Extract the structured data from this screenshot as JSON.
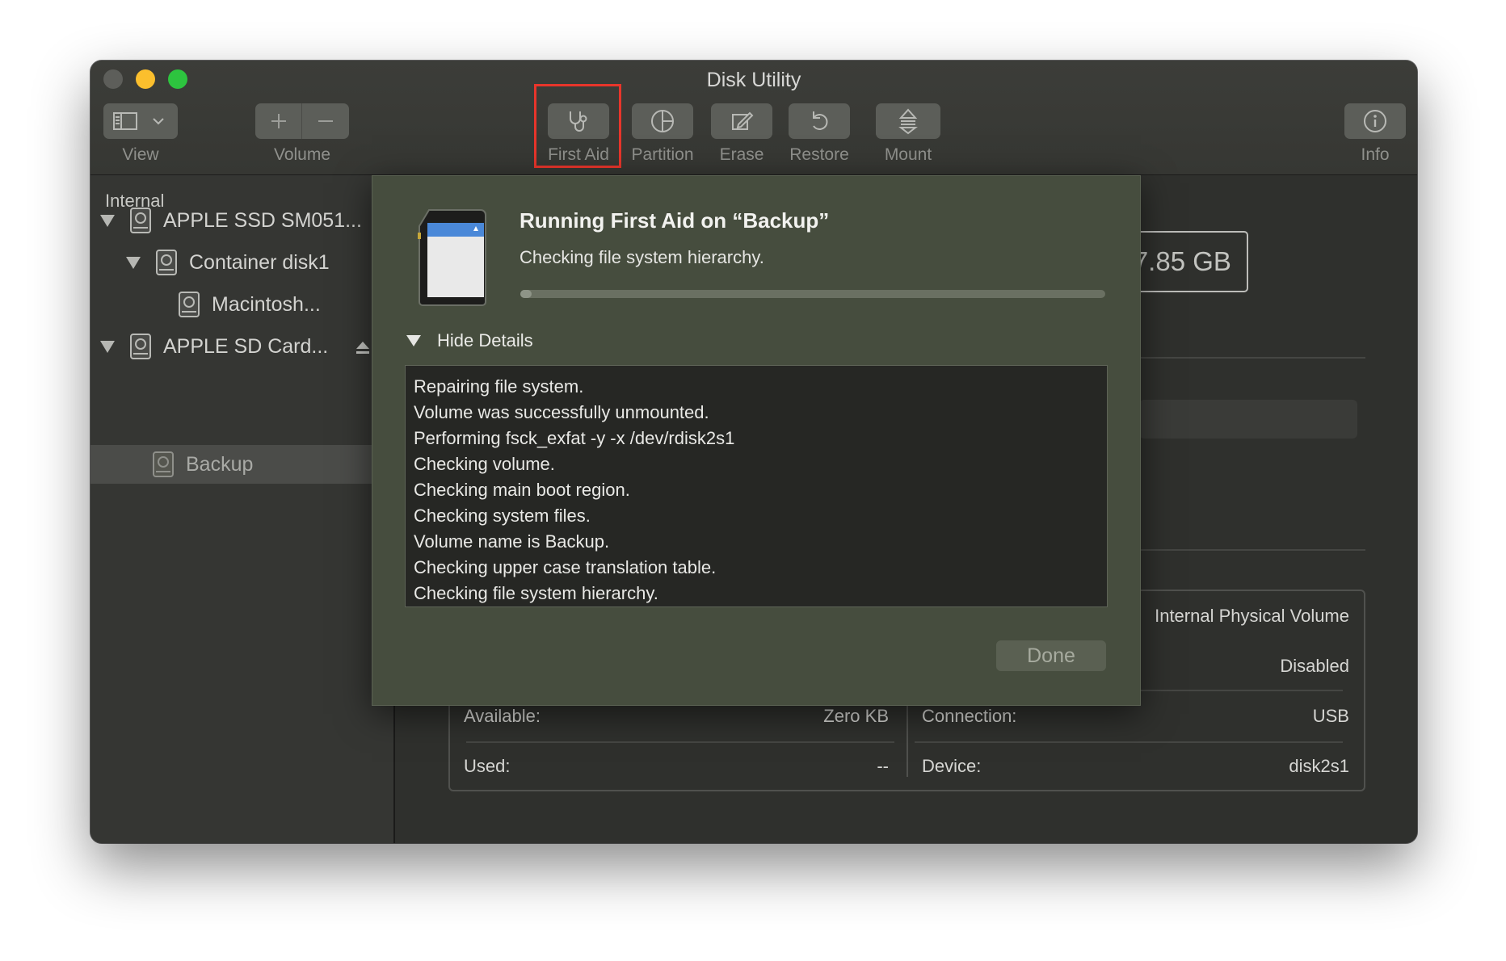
{
  "window": {
    "title": "Disk Utility"
  },
  "toolbar": {
    "view_label": "View",
    "volume_label": "Volume",
    "first_aid_label": "First Aid",
    "partition_label": "Partition",
    "erase_label": "Erase",
    "restore_label": "Restore",
    "mount_label": "Mount",
    "info_label": "Info"
  },
  "sidebar": {
    "header": "Internal",
    "items": [
      {
        "label": "APPLE SSD SM051..."
      },
      {
        "label": "Container disk1"
      },
      {
        "label": "Macintosh..."
      },
      {
        "label": "APPLE SD Card..."
      },
      {
        "label": "Backup"
      }
    ]
  },
  "main": {
    "capacity": "127.85 GB",
    "info": {
      "type_value": "Internal Physical Volume",
      "owners_value": "Disabled",
      "available_label": "Available:",
      "available_value": "Zero KB",
      "connection_label": "Connection:",
      "connection_value": "USB",
      "used_label": "Used:",
      "used_value": "--",
      "device_label": "Device:",
      "device_value": "disk2s1"
    }
  },
  "dialog": {
    "title": "Running First Aid on “Backup”",
    "status": "Checking file system hierarchy.",
    "progress": 0.02,
    "hide_details_label": "Hide Details",
    "log": [
      "Repairing file system.",
      "Volume was successfully unmounted.",
      "Performing fsck_exfat -y -x /dev/rdisk2s1",
      "Checking volume.",
      "Checking main boot region.",
      "Checking system files.",
      "Volume name is Backup.",
      "Checking upper case translation table.",
      "Checking file system hierarchy."
    ],
    "done_label": "Done"
  },
  "colors": {
    "highlight": "#e8352b",
    "close": "#5d5e5a",
    "minimize": "#fbbf2d",
    "maximize": "#2dc43f",
    "dialog_bg": "#464d3e"
  }
}
